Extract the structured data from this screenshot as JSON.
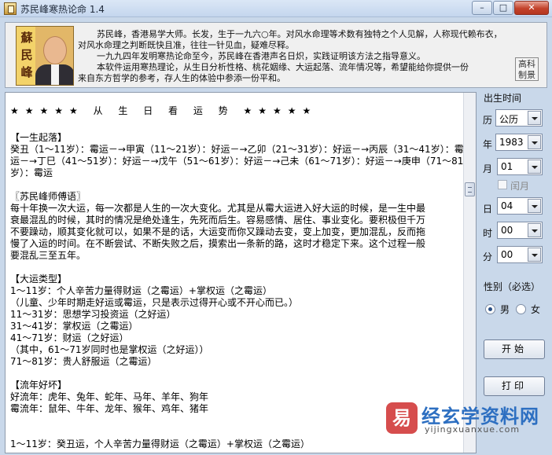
{
  "window": {
    "title": "苏民峰寒热论命 1.4",
    "min_label": "–",
    "max_label": "□",
    "close_label": "✕"
  },
  "header": {
    "portrait_calligraphy": "蘇民峰",
    "intro_lines": [
      "苏民峰，香港易学大师。长发，生于一九六○年。对风水命理等术数有独特之个人见解，人称现代赖布衣，",
      "对风水命理之判断既快且准，往往一针见血，疑难尽释。",
      "一九九四年发明寒热论命至今，苏民峰在香港声名日炽，实践证明该方法之指导意义。",
      "本软件运用寒热理论，从生日分析性格、桃花姻缘、大运起落、流年情况等，希望能给你提供一份",
      "来自东方哲学的参考，存人生的体验中参添一份平和。"
    ],
    "seal_text": "高科制景"
  },
  "content": {
    "heading": "★★★★★  从 生 日 看 运 势  ★★★★★",
    "lines": [
      "",
      "【一生起落】",
      "癸丑（1～11岁）：霉运－→甲寅（11～21岁）：好运－→乙卯（21～31岁）：好运－→丙辰（31～41岁）：霉",
      "运－→丁巳（41～51岁）：好运－→戊午（51～61岁）：好运－→己未（61～71岁）：好运－→庚申（71～81",
      "岁）：霉运",
      "",
      "〖苏民峰师傅语〗",
      "每十年换一次大运，每一次都是人生的一次大变化。尤其是从霉大运进入好大运的时候，是一生中最",
      "衰最混乱的时候，其时的情况是绝处逢生，先死而后生。容易感情、居住、事业变化。要积极但千万",
      "不要躁动，顺其变化就可以，如果不是的话，大运变而你又躁动去变，变上加变，更加混乱，反而拖",
      "慢了入运的时间。在不断尝试、不断失败之后，摸索出一条新的路，这时才稳定下来。这个过程一般",
      "要混乱三至五年。",
      "",
      "【大运类型】",
      "1～11岁：个人辛苦力量得财运（之霉运）+掌权运（之霉运）",
      "（儿童、少年时期走好运或霉运，只是表示过得开心或不开心而已。）",
      "11～31岁：思想学习投资运（之好运）",
      "31～41岁：掌权运（之霉运）",
      "41～71岁：财运（之好运）",
      "（其中，61～71岁同时也是掌权运（之好运））",
      "71～81岁：贵人舒服运（之霉运）",
      "",
      "【流年好坏】",
      "好流年：虎年、兔年、蛇年、马年、羊年、狗年",
      "霉流年：鼠年、牛年、龙年、猴年、鸡年、猪年",
      "",
      "",
      "1～11岁：癸丑运，个人辛苦力量得财运（之霉运）+掌权运（之霉运）"
    ]
  },
  "panel": {
    "section_title": "出生时间",
    "calendar_label": "历",
    "calendar_value": "公历",
    "year_label": "年",
    "year_value": "1983",
    "month_label": "月",
    "month_value": "01",
    "leap_label": "闰月",
    "day_label": "日",
    "day_value": "04",
    "hour_label": "时",
    "hour_value": "00",
    "minute_label": "分",
    "minute_value": "00",
    "gender_title": "性别（必选）",
    "male_label": "男",
    "female_label": "女",
    "start_button": "开始",
    "print_button": "打印"
  },
  "watermark": {
    "logo_char": "易",
    "title": "经玄学资料网",
    "url": "yijingxuanxue.com"
  },
  "colors": {
    "window_bg": "#c9d8ea",
    "close_button": "#c3422b",
    "watermark_blue": "#2d6fc1",
    "watermark_red": "#d23a3a"
  }
}
